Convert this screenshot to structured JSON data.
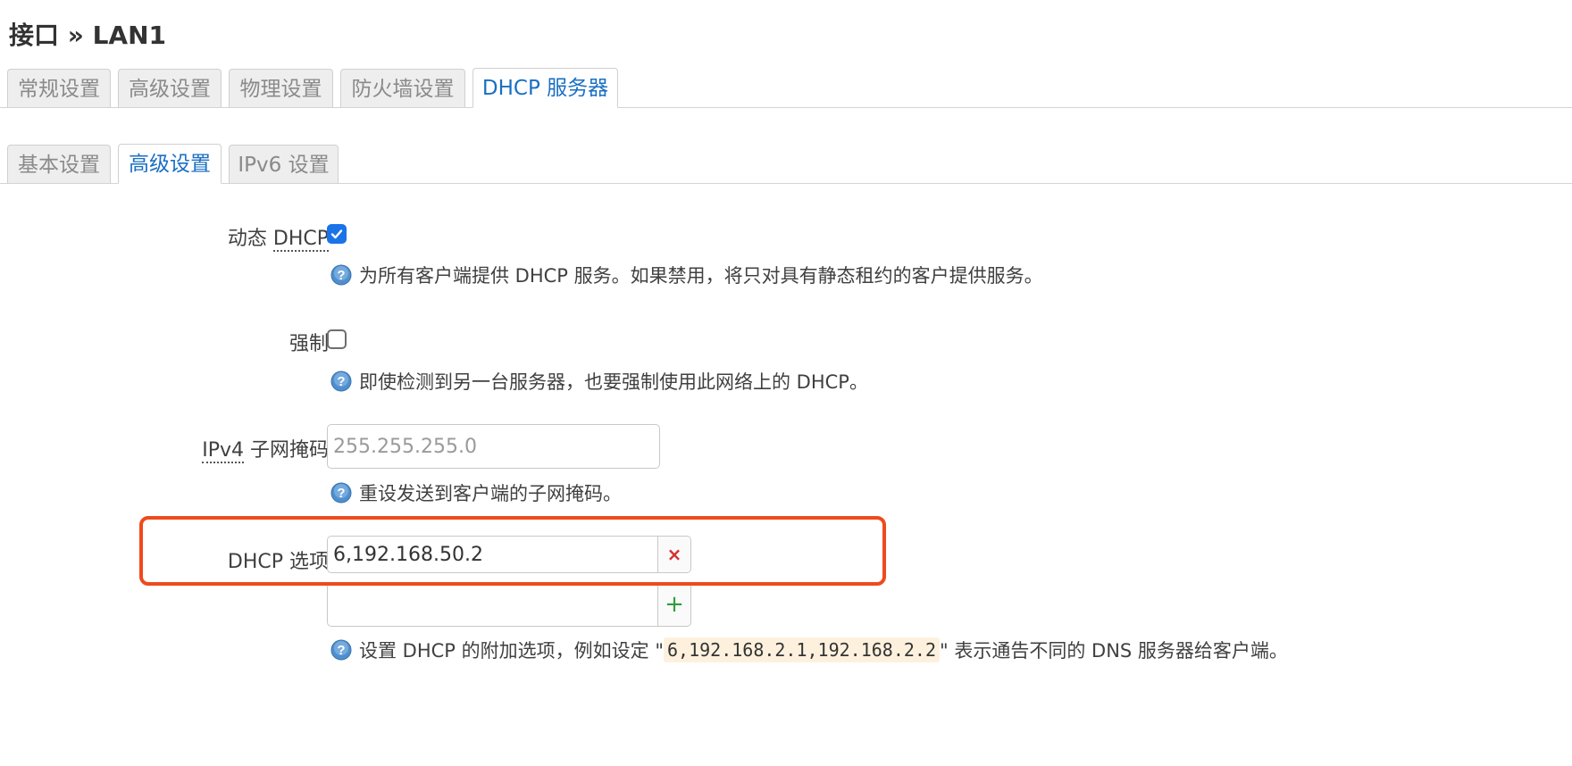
{
  "page": {
    "title": "接口 » LAN1"
  },
  "main_tabs": [
    {
      "label": "常规设置",
      "active": false
    },
    {
      "label": "高级设置",
      "active": false
    },
    {
      "label": "物理设置",
      "active": false
    },
    {
      "label": "防火墙设置",
      "active": false
    },
    {
      "label": "DHCP 服务器",
      "active": true
    }
  ],
  "sub_tabs": [
    {
      "label": "基本设置",
      "active": false
    },
    {
      "label": "高级设置",
      "active": true
    },
    {
      "label": "IPv6 设置",
      "active": false
    }
  ],
  "form": {
    "dynamic_dhcp": {
      "label_prefix": "动态 ",
      "label_abbr": "DHCP",
      "checked": true,
      "help": "为所有客户端提供 DHCP 服务。如果禁用，将只对具有静态租约的客户提供服务。"
    },
    "force": {
      "label": "强制",
      "checked": false,
      "help": "即使检测到另一台服务器，也要强制使用此网络上的 DHCP。"
    },
    "ipv4_netmask": {
      "label_abbr": "IPv4",
      "label_suffix": " 子网掩码",
      "value": "",
      "placeholder": "255.255.255.0",
      "help": "重设发送到客户端的子网掩码。"
    },
    "dhcp_options": {
      "label": "DHCP 选项",
      "values": [
        "6,192.168.50.2",
        ""
      ],
      "remove_symbol": "×",
      "add_symbol": "+",
      "help_prefix": "设置 DHCP 的附加选项，例如设定 \"",
      "help_code": "6,192.168.2.1,192.168.2.2",
      "help_suffix": "\" 表示通告不同的 DNS 服务器给客户端。"
    }
  },
  "colors": {
    "accent": "#1a6fc4",
    "highlight": "#ef4a1d",
    "checkbox": "#1a73e8"
  },
  "icons": {
    "help": "help-question-icon",
    "check": "checkmark-icon",
    "remove": "remove-x-icon",
    "add": "plus-icon"
  }
}
